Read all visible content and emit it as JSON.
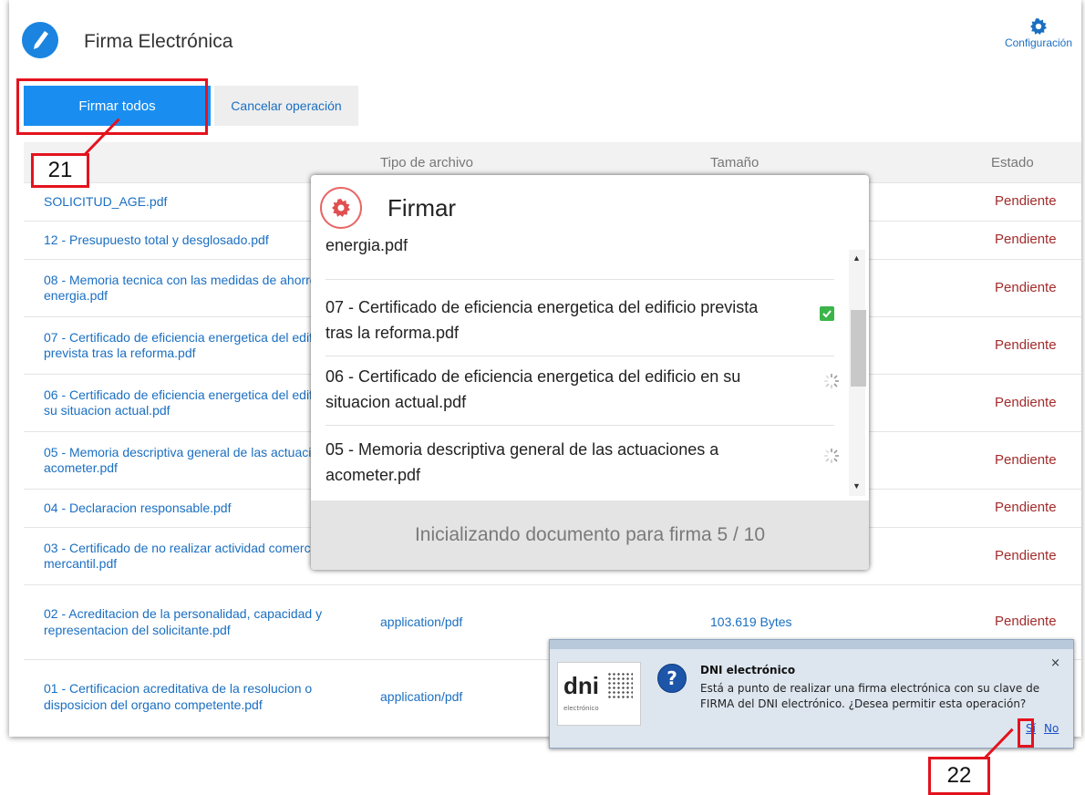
{
  "header": {
    "title": "Firma Electrónica",
    "config_label": "Configuración"
  },
  "actions": {
    "sign_all": "Firmar todos",
    "cancel": "Cancelar operación"
  },
  "table": {
    "columns": [
      "",
      "Tipo de archivo",
      "Tamaño",
      "Estado"
    ],
    "rows": [
      {
        "name": "SOLICITUD_AGE.pdf",
        "type": "",
        "size": "",
        "status": "Pendiente"
      },
      {
        "name": "12 - Presupuesto total y desglosado.pdf",
        "type": "",
        "size": "",
        "status": "Pendiente"
      },
      {
        "name": "08 - Memoria tecnica con las medidas de ahorro de energia.pdf",
        "type": "",
        "size": "",
        "status": "Pendiente"
      },
      {
        "name": "07 - Certificado de eficiencia energetica del edificio prevista tras la reforma.pdf",
        "type": "",
        "size": "",
        "status": "Pendiente"
      },
      {
        "name": "06 - Certificado de eficiencia energetica del edificio en su situacion actual.pdf",
        "type": "",
        "size": "",
        "status": "Pendiente"
      },
      {
        "name": "05 - Memoria descriptiva general de las actuaciones a acometer.pdf",
        "type": "",
        "size": "",
        "status": "Pendiente"
      },
      {
        "name": "04 - Declaracion responsable.pdf",
        "type": "",
        "size": "",
        "status": "Pendiente"
      },
      {
        "name": "03 - Certificado de no realizar actividad comercial o mercantil.pdf",
        "type": "",
        "size": "",
        "status": "Pendiente"
      },
      {
        "name": "02 - Acreditacion de la personalidad, capacidad y representacion del solicitante.pdf",
        "type": "application/pdf",
        "size": "103.619 Bytes",
        "status": "Pendiente"
      },
      {
        "name": "01 - Certificacion acreditativa de la resolucion o disposicion del organo competente.pdf",
        "type": "application/pdf",
        "size": "",
        "status": ""
      }
    ]
  },
  "modal": {
    "title": "Firmar",
    "items": [
      {
        "label": "energia.pdf",
        "status": "none"
      },
      {
        "label": "07 - Certificado de eficiencia energetica del edificio prevista tras la reforma.pdf",
        "status": "done"
      },
      {
        "label": "06 - Certificado de eficiencia energetica del edificio en su situacion actual.pdf",
        "status": "loading"
      },
      {
        "label": "05 - Memoria descriptiva general de las actuaciones a acometer.pdf",
        "status": "loading"
      }
    ],
    "footer": "Inicializando documento para firma 5 / 10"
  },
  "dni_dialog": {
    "logo_text": "dni",
    "logo_sub": "electrónico",
    "title": "DNI electrónico",
    "message": "Está a punto de realizar una firma electrónica con su clave de FIRMA del DNI electrónico. ¿Desea permitir esta operación?",
    "yes": "Sí",
    "no": "No",
    "close": "×"
  },
  "annotations": {
    "step1": "21",
    "step2": "22"
  },
  "colors": {
    "accent": "#1a8ef0",
    "pending": "#a32b2b",
    "callout": "#e3131e"
  }
}
